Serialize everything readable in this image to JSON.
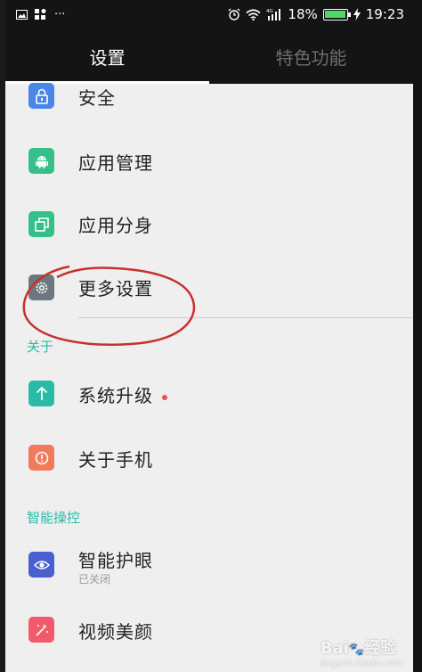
{
  "status_bar": {
    "time": "19:23",
    "battery": "18%",
    "left_icons": [
      "picture-icon",
      "notification-grid-icon",
      "more-dots-icon"
    ],
    "right_icons": [
      "alarm-icon",
      "wifi-icon",
      "signal-4g-icon",
      "battery-icon",
      "charging-icon"
    ]
  },
  "tabs": [
    {
      "label": "设置",
      "active": true
    },
    {
      "label": "特色功能",
      "active": false
    }
  ],
  "items": {
    "security": {
      "label": "安全",
      "icon": "lock-icon",
      "color": "#4a86e8"
    },
    "app_manage": {
      "label": "应用管理",
      "icon": "android-icon",
      "color": "#35c08a"
    },
    "app_clone": {
      "label": "应用分身",
      "icon": "clone-icon",
      "color": "#35c08a"
    },
    "more_settings": {
      "label": "更多设置",
      "icon": "gear-icon",
      "color": "#6e7780"
    },
    "system_update": {
      "label": "系统升级",
      "icon": "arrow-up-icon",
      "color": "#2abba6"
    },
    "about_phone": {
      "label": "关于手机",
      "icon": "info-icon",
      "color": "#f07a5a"
    },
    "eye_care": {
      "label": "智能护眼",
      "sub": "已关闭",
      "icon": "eye-icon",
      "color": "#4a5fd0"
    },
    "video_beauty": {
      "label": "视频美颜",
      "icon": "magic-wand-icon",
      "color": "#f25a6b"
    }
  },
  "sections": {
    "about": "关于",
    "smart_control": "智能操控"
  },
  "watermark": {
    "brand": "Bai",
    "brand2": "经验",
    "url": "jingyan.baidu.com"
  }
}
